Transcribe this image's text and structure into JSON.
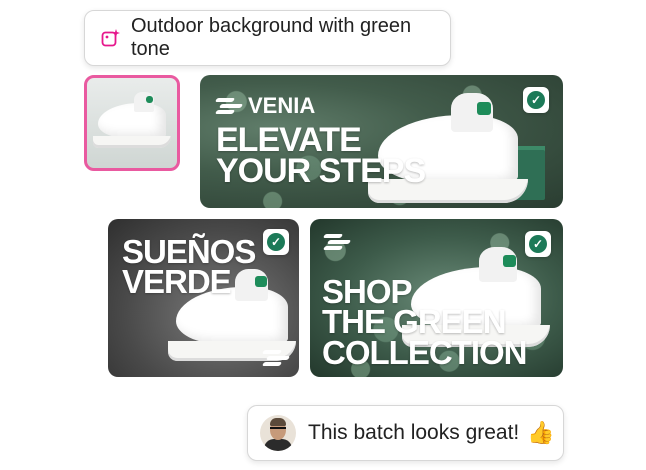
{
  "prompt": {
    "text": "Outdoor background with green tone",
    "icon": "sparkle-image-icon",
    "icon_color": "#e6178c"
  },
  "thumbnail": {
    "icon": "sneaker-reference-image",
    "border_color": "#e95aa0"
  },
  "banners": [
    {
      "brand": "VENIA",
      "headline": "ELEVATE\nYOUR STEPS",
      "selected": true,
      "check_glyph": "✓"
    },
    {
      "brand": "",
      "headline": "SUEÑOS\nVERDE",
      "selected": true,
      "check_glyph": "✓"
    },
    {
      "brand": "",
      "headline": "SHOP\nTHE GREEN\nCOLLECTION",
      "selected": true,
      "check_glyph": "✓"
    }
  ],
  "comment": {
    "text": "This batch looks great!",
    "emoji": "👍",
    "avatar": "user-avatar"
  },
  "colors": {
    "accent_green": "#1c7a58",
    "highlight_pink": "#e95aa0"
  }
}
